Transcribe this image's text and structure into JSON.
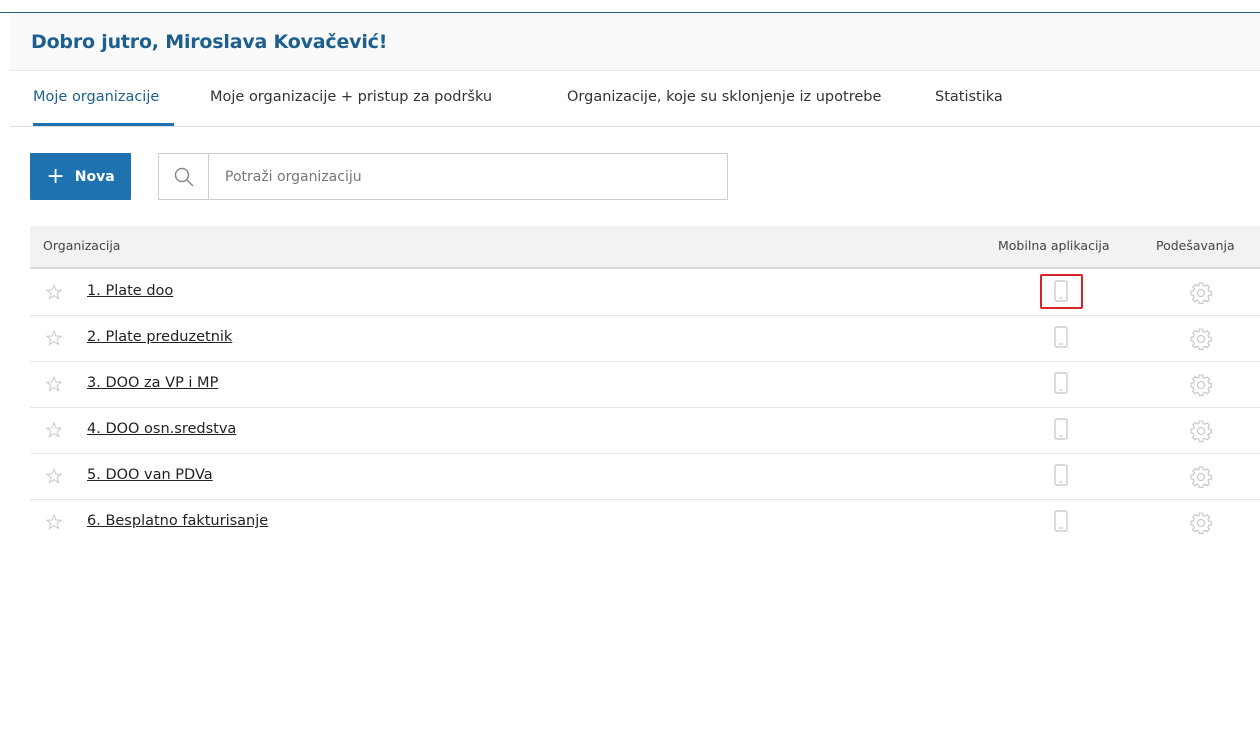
{
  "header": {
    "greeting": "Dobro jutro, Miroslava Kovačević!"
  },
  "tabs": [
    {
      "label": "Moje organizacije",
      "active": true
    },
    {
      "label": "Moje organizacije + pristup za podršku",
      "active": false
    },
    {
      "label": "Organizacije, koje su sklonjenje iz upotrebe",
      "active": false
    },
    {
      "label": "Statistika",
      "active": false
    }
  ],
  "toolbar": {
    "new_label": "Nova",
    "new_icon": "plus-icon"
  },
  "search": {
    "placeholder": "Potraži organizaciju",
    "value": "",
    "icon": "search-icon"
  },
  "table": {
    "columns": [
      "Organizacija",
      "Mobilna aplikacija",
      "Podešavanja"
    ],
    "rows": [
      {
        "name": "1. Plate doo",
        "highlighted": true
      },
      {
        "name": "2. Plate preduzetnik"
      },
      {
        "name": "3. DOO za VP i MP"
      },
      {
        "name": "4. DOO osn.sredstva"
      },
      {
        "name": "5. DOO van PDVa"
      },
      {
        "name": "6. Besplatno fakturisanje"
      }
    ]
  },
  "colors": {
    "accent": "#1f72b0",
    "title": "#1d5f8f",
    "highlight_border": "#d9232a",
    "icon_gray": "#c4c4c4"
  }
}
